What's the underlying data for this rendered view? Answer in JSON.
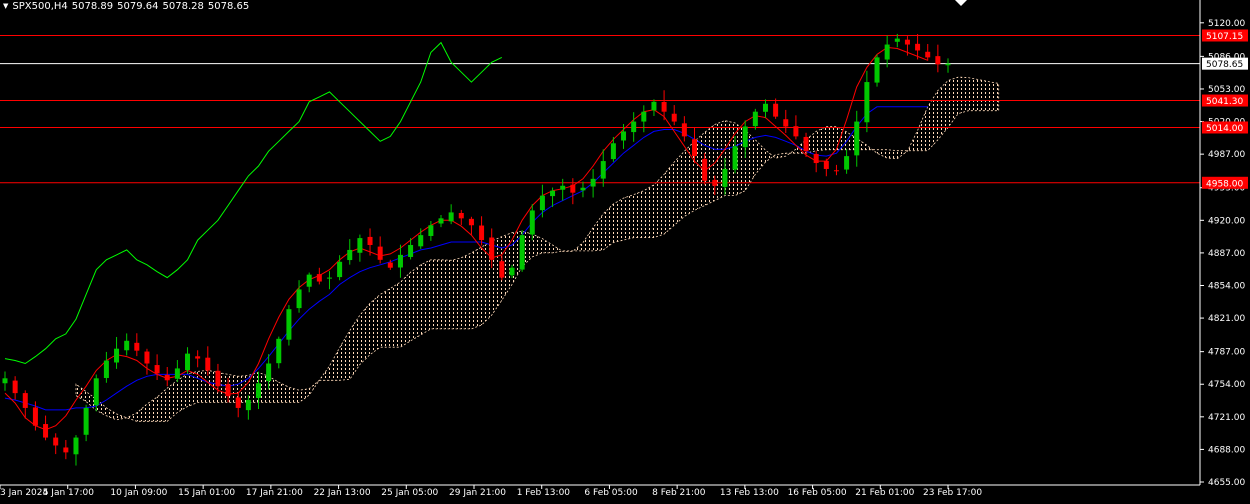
{
  "header": {
    "symbol": "SPX500,H4",
    "open": "5078.89",
    "high": "5079.64",
    "low": "5078.28",
    "close": "5078.65"
  },
  "colors": {
    "background": "#000000",
    "bull_candle": "#00c800",
    "bear_candle": "#ff0000",
    "tenkan": "#ff0000",
    "kijun": "#0000ff",
    "chikou": "#00ff00",
    "cloud": "#ffdab9",
    "hline": "#ff0000",
    "current_price_line": "#ffffff",
    "axis_text": "#ffffff"
  },
  "chart_data": {
    "type": "candlestick",
    "indicator": "Ichimoku Kinko Hyo",
    "ylim": [
      4655,
      5135
    ],
    "y_ticks": [
      "5120.00",
      "5086.00",
      "5053.00",
      "5020.00",
      "4987.00",
      "4953.00",
      "4920.00",
      "4887.00",
      "4854.00",
      "4821.00",
      "4787.00",
      "4754.00",
      "4721.00",
      "4688.00",
      "4655.00"
    ],
    "x_ticks": [
      "3 Jan 2024",
      "5 Jan 17:00",
      "10 Jan 09:00",
      "15 Jan 01:00",
      "17 Jan 21:00",
      "22 Jan 13:00",
      "25 Jan 05:00",
      "29 Jan 21:00",
      "1 Feb 13:00",
      "6 Feb 05:00",
      "8 Feb 21:00",
      "13 Feb 13:00",
      "16 Feb 05:00",
      "21 Feb 01:00",
      "23 Feb 17:00"
    ],
    "current_price": "5078.65",
    "horizontal_levels": [
      {
        "label": "5107.15",
        "value": 5107.15
      },
      {
        "label": "5041.30",
        "value": 5041.3
      },
      {
        "label": "5014.00",
        "value": 5014.0
      },
      {
        "label": "4958.00",
        "value": 4958.0
      }
    ],
    "price_path": [
      4760,
      4745,
      4730,
      4712,
      4700,
      4692,
      4685,
      4700,
      4730,
      4760,
      4778,
      4790,
      4798,
      4788,
      4775,
      4765,
      4758,
      4770,
      4785,
      4780,
      4768,
      4752,
      4742,
      4730,
      4738,
      4755,
      4775,
      4800,
      4830,
      4850,
      4865,
      4858,
      4862,
      4878,
      4890,
      4902,
      4895,
      4880,
      4872,
      4885,
      4895,
      4905,
      4915,
      4922,
      4928,
      4922,
      4915,
      4900,
      4880,
      4862,
      4872,
      4905,
      4930,
      4945,
      4950,
      4955,
      4948,
      4953,
      4962,
      4980,
      4998,
      5010,
      5020,
      5030,
      5040,
      5030,
      5020,
      5005,
      4985,
      4960,
      4955,
      4972,
      4995,
      5015,
      5030,
      5038,
      5025,
      5015,
      5005,
      4990,
      4978,
      4972,
      4970,
      4985,
      5020,
      5060,
      5085,
      5098,
      5104,
      5098,
      5092,
      5085,
      5078,
      5078.65
    ],
    "tenkan": [
      4745,
      4735,
      4720,
      4712,
      4708,
      4712,
      4722,
      4738,
      4752,
      4768,
      4778,
      4784,
      4782,
      4778,
      4770,
      4764,
      4760,
      4762,
      4768,
      4764,
      4756,
      4748,
      4744,
      4745,
      4756,
      4775,
      4800,
      4822,
      4840,
      4852,
      4860,
      4864,
      4870,
      4880,
      4888,
      4892,
      4888,
      4884,
      4886,
      4892,
      4900,
      4908,
      4915,
      4920,
      4920,
      4914,
      4905,
      4892,
      4882,
      4885,
      4900,
      4920,
      4935,
      4945,
      4950,
      4952,
      4955,
      4962,
      4975,
      4990,
      5002,
      5012,
      5022,
      5030,
      5032,
      5025,
      5010,
      4995,
      4980,
      4970,
      4978,
      4992,
      5008,
      5020,
      5026,
      5024,
      5015,
      5006,
      4996,
      4986,
      4980,
      4980,
      4992,
      5022,
      5055,
      5075,
      5088,
      5095,
      5094,
      5090,
      5086,
      5082
    ],
    "kijun": [
      4740,
      4738,
      4735,
      4732,
      4728,
      4728,
      4728,
      4730,
      4730,
      4732,
      4738,
      4745,
      4752,
      4758,
      4762,
      4764,
      4764,
      4764,
      4764,
      4760,
      4756,
      4754,
      4752,
      4754,
      4760,
      4770,
      4782,
      4795,
      4808,
      4820,
      4830,
      4838,
      4845,
      4855,
      4862,
      4868,
      4872,
      4875,
      4878,
      4882,
      4886,
      4890,
      4892,
      4895,
      4898,
      4898,
      4898,
      4898,
      4895,
      4892,
      4895,
      4905,
      4918,
      4928,
      4935,
      4940,
      4945,
      4950,
      4958,
      4968,
      4978,
      4988,
      4996,
      5004,
      5010,
      5012,
      5012,
      5008,
      5002,
      4996,
      4992,
      4992,
      4995,
      5000,
      5004,
      5006,
      5004,
      5000,
      4996,
      4990,
      4986,
      4985,
      4988,
      5000,
      5015,
      5028,
      5035,
      5035,
      5035,
      5035,
      5035,
      5035
    ],
    "chikou": [
      4780,
      4778,
      4775,
      4782,
      4790,
      4800,
      4805,
      4820,
      4845,
      4870,
      4880,
      4885,
      4890,
      4880,
      4875,
      4868,
      4862,
      4870,
      4880,
      4900,
      4910,
      4920,
      4935,
      4950,
      4965,
      4975,
      4990,
      5000,
      5010,
      5020,
      5040,
      5045,
      5050,
      5040,
      5030,
      5020,
      5010,
      5000,
      5005,
      5020,
      5040,
      5060,
      5090,
      5100,
      5080,
      5070,
      5060,
      5070,
      5080,
      5085
    ]
  }
}
